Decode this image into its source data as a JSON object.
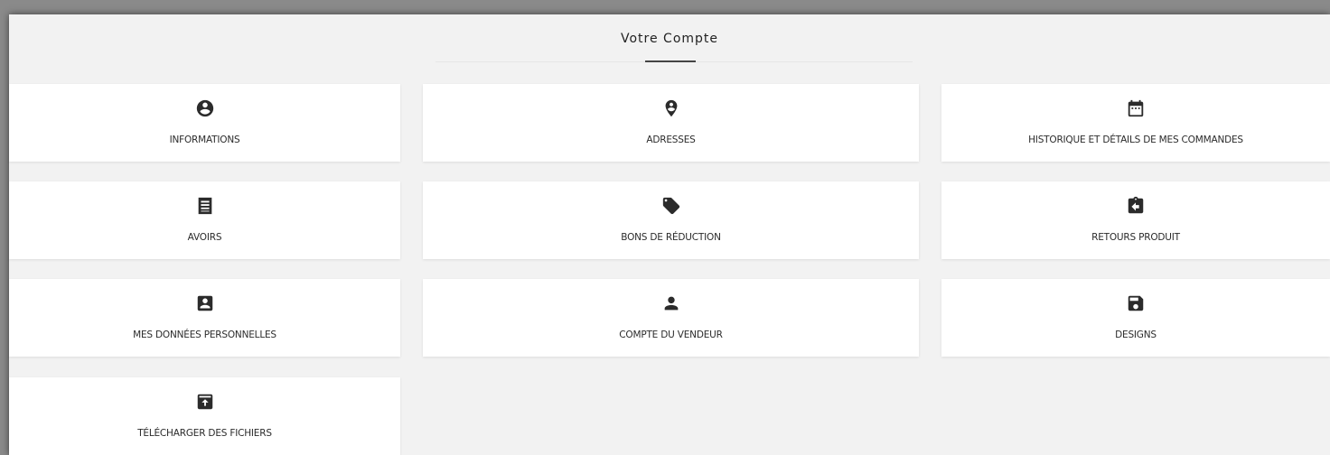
{
  "page": {
    "title": "Votre Compte"
  },
  "cards": [
    {
      "label": "INFORMATIONS",
      "icon": "account-circle-icon"
    },
    {
      "label": "ADRESSES",
      "icon": "location-pin-icon"
    },
    {
      "label": "HISTORIQUE ET DÉTAILS DE MES COMMANDES",
      "icon": "calendar-icon"
    },
    {
      "label": "AVOIRS",
      "icon": "receipt-icon"
    },
    {
      "label": "BONS DE RÉDUCTION",
      "icon": "tag-icon"
    },
    {
      "label": "RETOURS PRODUIT",
      "icon": "assignment-return-icon"
    },
    {
      "label": "MES DONNÉES PERSONNELLES",
      "icon": "account-box-icon"
    },
    {
      "label": "COMPTE DU VENDEUR",
      "icon": "person-icon"
    },
    {
      "label": "DESIGNS",
      "icon": "save-icon"
    },
    {
      "label": "TÉLÉCHARGER DES FICHIERS",
      "icon": "upload-box-icon"
    }
  ],
  "colors": {
    "icon": "#2b2b2b",
    "card_background": "#ffffff",
    "panel_background": "#f2f2f2"
  }
}
